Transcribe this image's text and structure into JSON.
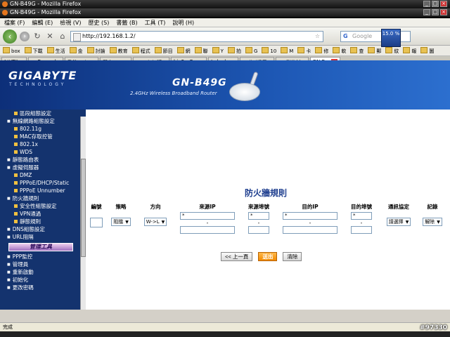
{
  "window": {
    "title_back": "GN-B49G - Mozilla Firefox",
    "title_front": "GN-B49G - Mozilla Firefox"
  },
  "menu": [
    "檔案 (F)",
    "編輯 (E)",
    "檢視 (V)",
    "歷史 (S)",
    "書籤 (B)",
    "工具 (T)",
    "說明 (H)"
  ],
  "nav": {
    "url": "http://192.168.1.2/",
    "search_placeholder": "Google",
    "clock": "15.0 %"
  },
  "bookmarks": [
    "box",
    "下載",
    "生活",
    "金",
    "討論",
    "教育",
    "程式",
    "節目",
    "網",
    "聯",
    "Y",
    "拍",
    "G",
    "10",
    "M",
    "卡",
    "修",
    "軟",
    "查",
    "郵",
    "紋",
    "報",
    "圖"
  ],
  "tabs": [
    {
      "label": "[分享] ..."
    },
    {
      "label": "::: Reward..."
    },
    {
      "label": "政治-Yaho..."
    },
    {
      "label": "印度 VIST..."
    },
    {
      "label": "HD.club 精..."
    },
    {
      "label": "big5 - Ope..."
    },
    {
      "label": "twbsd.org"
    },
    {
      "label": "Hulk (綠巨..."
    },
    {
      "label": "HD影片討..."
    },
    {
      "label": "GN-B..."
    }
  ],
  "banner": {
    "logo": "GIGABYTE",
    "logo_sub": "TECHNOLOGY",
    "model": "GN-B49G",
    "model_sub": "2.4GHz Wireless Broadband Router"
  },
  "sidebar": {
    "items": [
      {
        "label": "區段組態設定",
        "level": 2
      },
      {
        "label": "無線網路組態設定",
        "level": 1
      },
      {
        "label": "802.11g",
        "level": 2
      },
      {
        "label": "MAC存取控管",
        "level": 2
      },
      {
        "label": "802.1x",
        "level": 2
      },
      {
        "label": "WDS",
        "level": 2
      },
      {
        "label": "靜態路由表",
        "level": 1
      },
      {
        "label": "虛擬伺服器",
        "level": 1
      },
      {
        "label": "DMZ",
        "level": 2
      },
      {
        "label": "PPPoE/DHCP/Static",
        "level": 2
      },
      {
        "label": "PPPoE Unnumber",
        "level": 2
      },
      {
        "label": "防火牆規則",
        "level": 1
      },
      {
        "label": "安全性組態設定",
        "level": 2
      },
      {
        "label": "VPN通過",
        "level": 2
      },
      {
        "label": "靜態規則",
        "level": 2
      },
      {
        "label": "DNS組態設定",
        "level": 1
      },
      {
        "label": "URL阻隔",
        "level": 1
      }
    ],
    "section_head": "管理工具",
    "tools": [
      {
        "label": "PPP監控"
      },
      {
        "label": "管理員"
      },
      {
        "label": "重新啟動"
      },
      {
        "label": "初始化"
      },
      {
        "label": "更改密碼"
      }
    ]
  },
  "main": {
    "title": "防火牆規則",
    "columns": [
      "編號",
      "策略",
      "方向",
      "來源IP",
      "來源埠號",
      "目的IP",
      "目的埠號",
      "通訊協定",
      "記錄"
    ],
    "row": {
      "number": "",
      "policy": "阻擋",
      "direction": "W->L",
      "src_ip_from": "*",
      "src_ip_sep": "-",
      "src_ip_to": "",
      "src_port_from": "*",
      "src_port_sep": "-",
      "src_port_to": "",
      "dst_ip_from": "*",
      "dst_ip_sep": "-",
      "dst_ip_to": "",
      "dst_port_from": "*",
      "dst_port_sep": "-",
      "dst_port_to": "",
      "protocol": "請選擇",
      "log": "解除"
    },
    "buttons": {
      "prev": "<< 上一頁",
      "submit": "送出",
      "clear": "清除"
    }
  },
  "status": "完成",
  "watermark": "#97330"
}
